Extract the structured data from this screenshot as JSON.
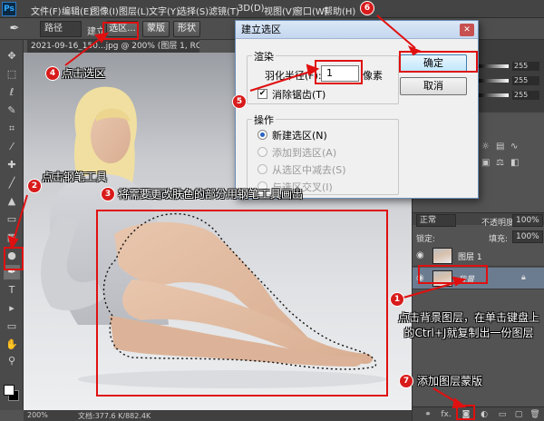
{
  "menubar": {
    "logo": "Ps",
    "items": [
      "文件(F)",
      "编辑(E)",
      "图像(I)",
      "图层(L)",
      "文字(Y)",
      "选择(S)",
      "滤镜(T)",
      "3D(D)",
      "视图(V)",
      "窗口(W)",
      "帮助(H)"
    ]
  },
  "options": {
    "mode": "路径",
    "make_label": "建立:",
    "selection_btn": "选区...",
    "mask_btn": "蒙版",
    "shape_btn": "形状"
  },
  "document": {
    "tab_title": "2021-09-16_150...jpg @ 200% (图层 1, RGB/8#) *",
    "zoom": "200%",
    "doc_size": "文档:377.6 K/882.4K"
  },
  "dialog": {
    "title": "建立选区",
    "render_group": "渲染",
    "feather_label": "羽化半径(F):",
    "feather_value": "1",
    "feather_unit": "像素",
    "antialias_label": "消除锯齿(T)",
    "operation_group": "操作",
    "op_new": "新建选区(N)",
    "op_add": "添加到选区(A)",
    "op_subtract": "从选区中减去(S)",
    "op_intersect": "与选区交叉(I)",
    "ok": "确定",
    "cancel": "取消"
  },
  "color_panel": {
    "values": [
      "255",
      "255",
      "255"
    ]
  },
  "layers": {
    "blend_mode": "正常",
    "opacity_label": "不透明度:",
    "opacity": "100%",
    "lock_label": "锁定:",
    "fill_label": "填充:",
    "fill": "100%",
    "items": [
      {
        "name": "图层 1",
        "selected": false
      },
      {
        "name": "背景",
        "selected": true,
        "locked": true
      }
    ],
    "footer_fx": "fx."
  },
  "annotations": [
    {
      "num": "1",
      "text": "点击背景图层，在单击键盘上的Ctrl+J就复制出一份图层"
    },
    {
      "num": "2",
      "text": "点击钢笔工具"
    },
    {
      "num": "3",
      "text": "将需要更改肤色的部分用钢笔工具画出"
    },
    {
      "num": "4",
      "text": "点击选区"
    },
    {
      "num": "5",
      "text": ""
    },
    {
      "num": "6",
      "text": ""
    },
    {
      "num": "7",
      "text": "添加图层蒙版"
    }
  ],
  "colors": {
    "annotation_red": "#e01010",
    "selected_layer": "#6b7c91",
    "ps_dark": "#535353"
  }
}
